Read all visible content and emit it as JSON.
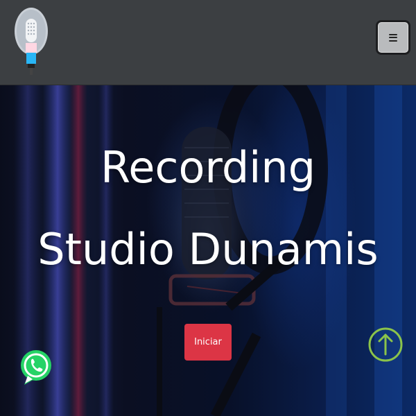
{
  "hero": {
    "title_line1": "Recording",
    "title_line2": "Studio Dunamis",
    "start_button": "Iniciar"
  },
  "icons": {
    "logo": "microphone-logo-icon",
    "menu": "hamburger-menu-icon",
    "whatsapp": "whatsapp-icon",
    "scroll_top": "arrow-up-circle-icon"
  },
  "colors": {
    "navbar": "#3c3f42",
    "primary_button": "#dc3545",
    "whatsapp": "#25d366",
    "scroll_top": "#8bc34a"
  }
}
